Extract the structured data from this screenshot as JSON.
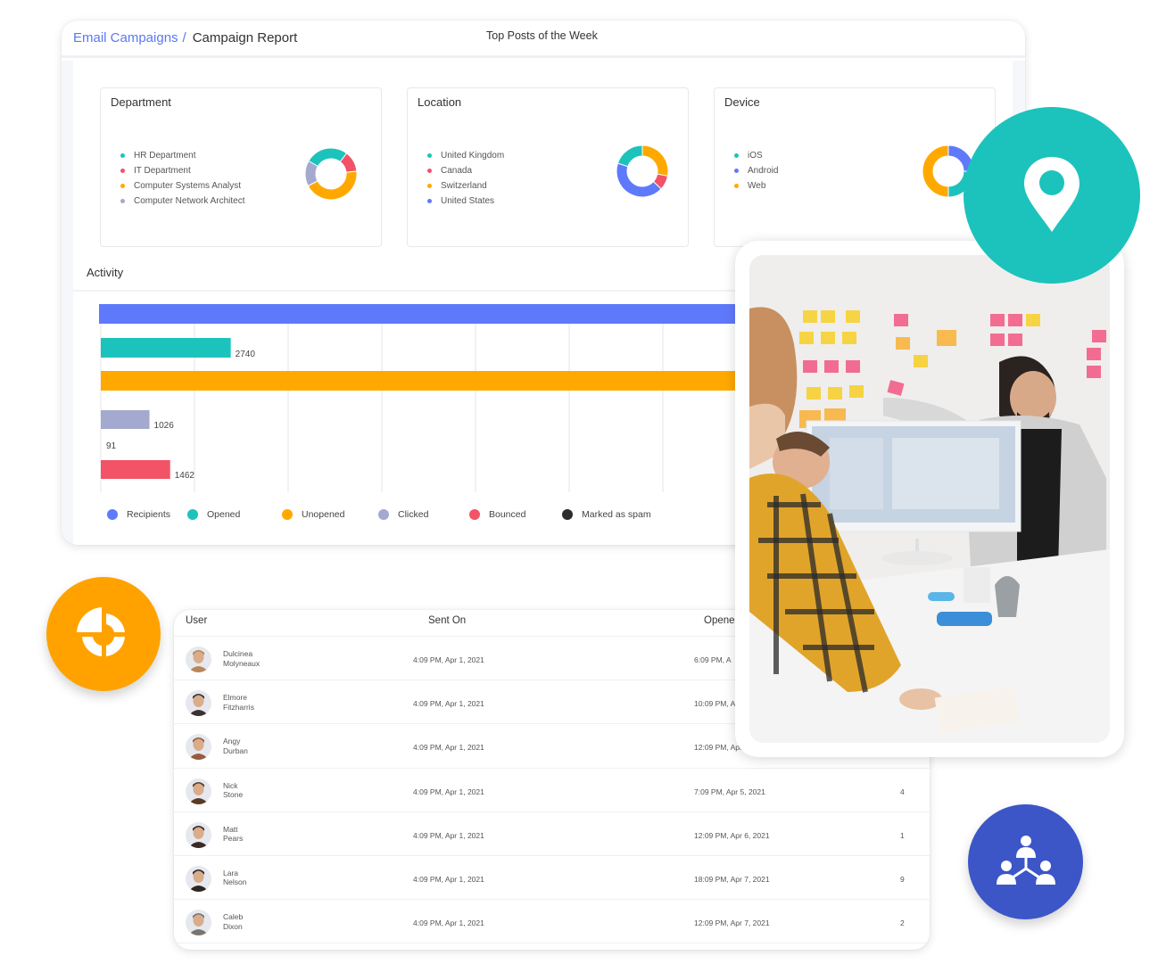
{
  "header": {
    "breadcrumb_parent": "Email Campaigns",
    "breadcrumb_separator": "/",
    "breadcrumb_current": "Campaign Report",
    "top_posts_label": "Top Posts of the Week"
  },
  "colors": {
    "accent": "#5b78f4",
    "teal": "#1cc3bc",
    "red": "#f25366",
    "orange": "#ffa900",
    "lavender": "#a3a9cf",
    "blue": "#5f79fb",
    "dark": "#2d2d2d",
    "network_badge": "#3c56c8",
    "pie_badge": "#ffa200"
  },
  "stat_cards": [
    {
      "title": "Department",
      "items": [
        {
          "label": "HR Department",
          "color": "#1cc3bc",
          "share": 27
        },
        {
          "label": "IT Department",
          "color": "#f25366",
          "share": 13
        },
        {
          "label": "Computer Systems Analyst",
          "color": "#ffa900",
          "share": 44
        },
        {
          "label": "Computer Network Architect",
          "color": "#a3a9cf",
          "share": 16
        }
      ],
      "start_angle_deg": -60
    },
    {
      "title": "Location",
      "items": [
        {
          "label": "United Kingdom",
          "color": "#1cc3bc",
          "share": 20
        },
        {
          "label": "Canada",
          "color": "#f25366",
          "share": 9
        },
        {
          "label": "Switzerland",
          "color": "#ffa900",
          "share": 28
        },
        {
          "label": "United States",
          "color": "#5f79fb",
          "share": 43
        }
      ],
      "order": [
        2,
        1,
        3,
        0
      ],
      "start_angle_deg": 0
    },
    {
      "title": "Device",
      "items": [
        {
          "label": "iOS",
          "color": "#1cc3bc",
          "share": 25
        },
        {
          "label": "Android",
          "color": "#5f79fb",
          "share": 25
        },
        {
          "label": "Web",
          "color": "#ffa900",
          "share": 50
        }
      ],
      "order": [
        1,
        0,
        2
      ],
      "start_angle_deg": 0
    }
  ],
  "activity": {
    "title": "Activity"
  },
  "chart_data": {
    "type": "bar",
    "orientation": "horizontal",
    "title": "Activity",
    "categories": [
      "Recipients",
      "Opened",
      "Unopened",
      "Clicked",
      "Bounced",
      "Marked as spam"
    ],
    "series": [
      {
        "name": "Recipients",
        "value": null,
        "color": "#5f79fb",
        "label": ""
      },
      {
        "name": "Opened",
        "value": 2740,
        "color": "#1cc3bc",
        "label": "2740"
      },
      {
        "name": "Unopened",
        "value": null,
        "color": "#ffa900",
        "label": ""
      },
      {
        "name": "Clicked",
        "value": 1026,
        "color": "#a3a9cf",
        "label": "1026"
      },
      {
        "name": "Marked as spam",
        "value": 91,
        "color": "#2d2d2d",
        "label": "91"
      },
      {
        "name": "Bounced",
        "value": 1462,
        "color": "#f25366",
        "label": "1462"
      }
    ],
    "xlim": [
      0,
      19000
    ],
    "grid": true,
    "legend": "bottom",
    "legend_items": [
      {
        "label": "Recipients",
        "color": "#5f79fb"
      },
      {
        "label": "Opened",
        "color": "#1cc3bc"
      },
      {
        "label": "Unopened",
        "color": "#ffa900"
      },
      {
        "label": "Clicked",
        "color": "#a3a9cf"
      },
      {
        "label": "Bounced",
        "color": "#f25366"
      },
      {
        "label": "Marked as spam",
        "color": "#2d2d2d"
      }
    ]
  },
  "table": {
    "headers": [
      "User",
      "Sent On",
      "Opened"
    ],
    "rows": [
      {
        "first": "Dulcinea",
        "last": "Molyneaux",
        "sent": "4:09 PM, Apr 1, 2021",
        "opened": "6:09 PM, A",
        "count": "",
        "avatar_color": "#b88658"
      },
      {
        "first": "Elmore",
        "last": "Fitzharris",
        "sent": "4:09 PM, Apr 1, 2021",
        "opened": "10:09 PM, A",
        "count": "",
        "avatar_color": "#3b3230"
      },
      {
        "first": "Angy",
        "last": "Durban",
        "sent": "4:09 PM, Apr 1, 2021",
        "opened": "12:09 PM, Apr",
        "count": "",
        "avatar_color": "#9a5a3c"
      },
      {
        "first": "Nick",
        "last": "Stone",
        "sent": "4:09 PM, Apr 1, 2021",
        "opened": "7:09 PM, Apr 5, 2021",
        "count": "4",
        "avatar_color": "#5a3b22"
      },
      {
        "first": "Matt",
        "last": "Pears",
        "sent": "4:09 PM, Apr 1, 2021",
        "opened": "12:09 PM, Apr 6, 2021",
        "count": "1",
        "avatar_color": "#3a2a26"
      },
      {
        "first": "Lara",
        "last": "Nelson",
        "sent": "4:09 PM, Apr 1, 2021",
        "opened": "18:09 PM, Apr 7, 2021",
        "count": "9",
        "avatar_color": "#2f2520"
      },
      {
        "first": "Caleb",
        "last": "Dixon",
        "sent": "4:09 PM, Apr 1, 2021",
        "opened": "12:09 PM, Apr 7, 2021",
        "count": "2",
        "avatar_color": "#7a7470"
      }
    ]
  },
  "badges": {
    "location_icon": "map-pin-icon",
    "pie_icon": "pie-chart-icon",
    "network_icon": "team-network-icon"
  },
  "photo": {
    "description": "team-meeting-photo"
  }
}
